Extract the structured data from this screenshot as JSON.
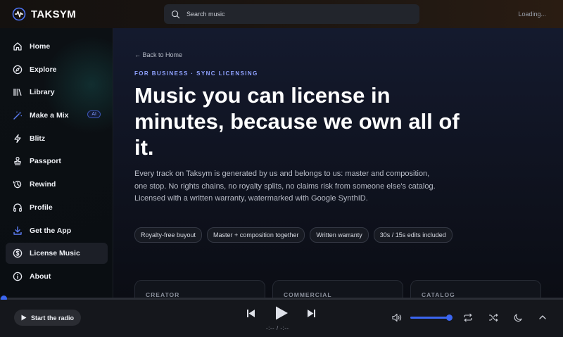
{
  "app": {
    "name": "TAKSYM",
    "status": "Loading..."
  },
  "search": {
    "placeholder": "Search music"
  },
  "sidebar": {
    "items": [
      {
        "label": "Home",
        "icon": "home-icon"
      },
      {
        "label": "Explore",
        "icon": "compass-icon"
      },
      {
        "label": "Library",
        "icon": "library-icon"
      },
      {
        "label": "Make a Mix",
        "icon": "magic-wand-icon",
        "badge": "AI"
      },
      {
        "label": "Blitz",
        "icon": "bolt-icon"
      },
      {
        "label": "Passport",
        "icon": "stamp-icon"
      },
      {
        "label": "Rewind",
        "icon": "history-icon"
      },
      {
        "label": "Profile",
        "icon": "headphones-icon"
      },
      {
        "label": "Get the App",
        "icon": "download-icon"
      },
      {
        "label": "License Music",
        "icon": "dollar-circle-icon",
        "active": true
      },
      {
        "label": "About",
        "icon": "info-icon"
      }
    ]
  },
  "main": {
    "back_link": "← Back to Home",
    "eyebrow": "FOR BUSINESS · SYNC LICENSING",
    "headline": "Music you can license in minutes, because we own all of it.",
    "lead": "Every track on Taksym is generated by us and belongs to us: master and composition, one stop. No rights chains, no royalty splits, no claims risk from someone else's catalog. Licensed with a written warranty, watermarked with Google SynthID.",
    "chips": [
      "Royalty-free buyout",
      "Master + composition together",
      "Written warranty",
      "30s / 15s edits included"
    ],
    "cards": [
      "CREATOR",
      "COMMERCIAL",
      "CATALOG"
    ]
  },
  "player": {
    "radio_label": "Start the radio",
    "time": "-:-- / -:--",
    "volume": 1.0,
    "progress": 0.0
  },
  "colors": {
    "accent": "#3b66f0",
    "eyebrow": "#8fa2ff",
    "badge": "#7f9cff"
  }
}
